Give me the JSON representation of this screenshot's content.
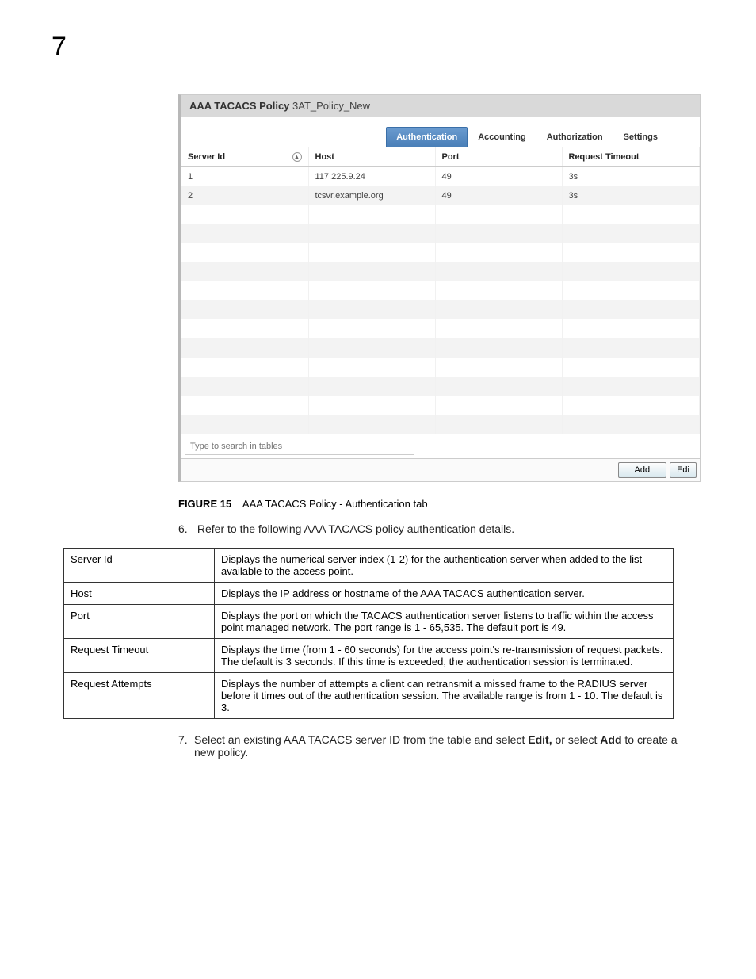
{
  "chapter": "7",
  "panel": {
    "title_bold": "AAA TACACS Policy",
    "title_name": "3AT_Policy_New",
    "tabs": [
      "Authentication",
      "Accounting",
      "Authorization",
      "Settings"
    ],
    "headers": {
      "server_id": "Server Id",
      "host": "Host",
      "port": "Port",
      "timeout": "Request Timeout"
    },
    "rows": [
      {
        "id": "1",
        "host": "117.225.9.24",
        "port": "49",
        "timeout": "3s"
      },
      {
        "id": "2",
        "host": "tcsvr.example.org",
        "port": "49",
        "timeout": "3s"
      }
    ],
    "search_placeholder": "Type to search in tables",
    "btn_add": "Add",
    "btn_edit": "Edi"
  },
  "figure": {
    "label": "FIGURE 15",
    "caption": "AAA TACACS Policy - Authentication tab"
  },
  "step6": {
    "num": "6.",
    "text": "Refer to the following AAA TACACS policy authentication details."
  },
  "desc": [
    {
      "label": "Server Id",
      "text": "Displays the numerical server index (1-2) for the authentication server when added to the list available to the access point."
    },
    {
      "label": "Host",
      "text": "Displays the IP address or hostname of the AAA TACACS authentication server."
    },
    {
      "label": "Port",
      "text": "Displays the port on which the TACACS authentication server listens to traffic within the access point managed network. The port range is 1 - 65,535. The default port is 49."
    },
    {
      "label": "Request Timeout",
      "text": "Displays the time (from 1 - 60 seconds) for the access point's re-transmission of request packets. The default is 3 seconds. If this time is exceeded, the authentication session is terminated."
    },
    {
      "label": "Request Attempts",
      "text": "Displays the number of attempts a client can retransmit a missed frame to the RADIUS server before it times out of the authentication session. The available range is from 1 - 10. The default is 3."
    }
  ],
  "step7": {
    "num": "7.",
    "pre": "Select an existing AAA TACACS server ID from the table and select ",
    "edit": "Edit,",
    "mid": " or select ",
    "add": "Add",
    "post": " to create a new policy."
  }
}
